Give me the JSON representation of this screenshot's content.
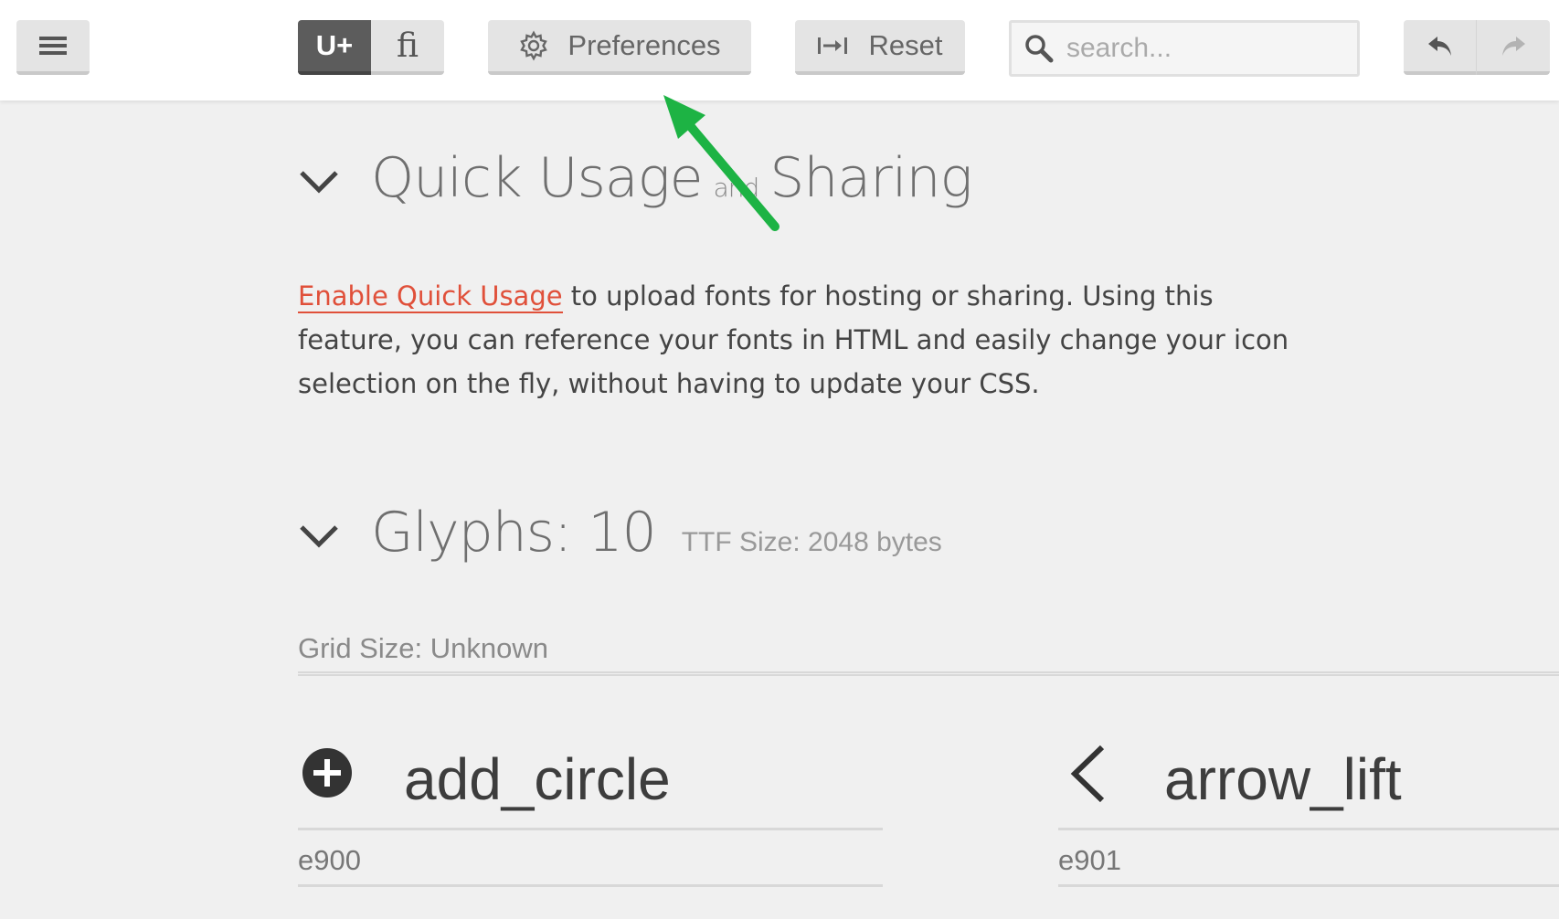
{
  "toolbar": {
    "menu_icon": "hamburger-menu-icon",
    "unicode_toggle_label": "U+",
    "ligature_toggle_label": "ﬁ",
    "preferences_label": "Preferences",
    "preferences_icon": "gear-icon",
    "reset_label": "Reset",
    "reset_icon": "arrow-to-bar-icon",
    "search_placeholder": "search...",
    "undo_icon": "undo-icon",
    "redo_icon": "redo-icon"
  },
  "quick_usage": {
    "title_part1": "Quick Usage",
    "title_and": "and",
    "title_part2": "Sharing",
    "link_text": "Enable Quick Usage",
    "description": " to upload fonts for hosting or sharing. Using this feature, you can reference your fonts in HTML and easily change your icon selection on the fly, without having to update your CSS."
  },
  "glyphs": {
    "title": "Glyphs: 10",
    "ttf_size": "TTF Size: 2048 bytes",
    "grid_size": "Grid Size: Unknown",
    "items": [
      {
        "name": "add_circle",
        "code": "e900",
        "icon": "add-circle-icon"
      },
      {
        "name": "arrow_lift",
        "code": "e901",
        "icon": "chevron-left-icon"
      }
    ]
  },
  "colors": {
    "link": "#e0503a",
    "annotation_arrow": "#1db344",
    "toggle_active": "#5c5c5c"
  }
}
